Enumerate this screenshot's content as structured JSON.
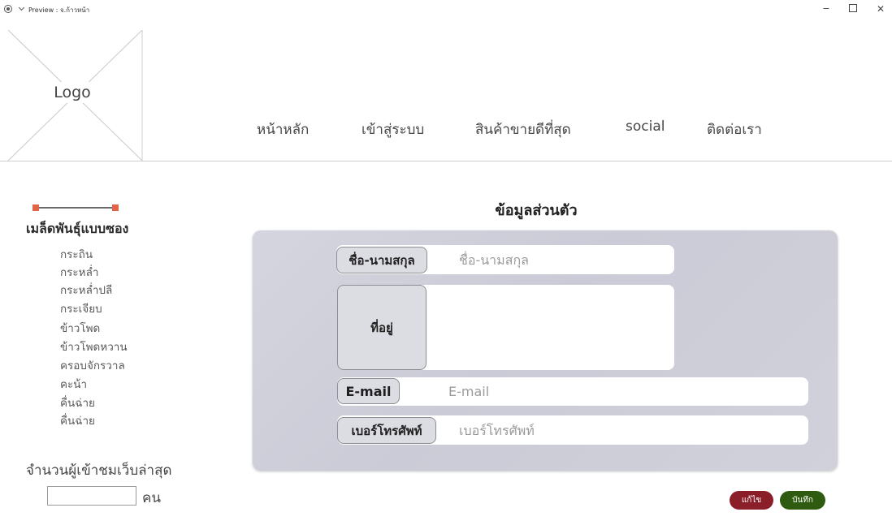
{
  "window": {
    "title": "Preview : จ.ก้าวหน้า",
    "minimize": "−",
    "close": "✕"
  },
  "logo": {
    "text": "Logo"
  },
  "nav": [
    "หน้าหลัก",
    "เข้าสู่ระบบ",
    "สินค้าขายดีที่สุด",
    "social",
    "ติดต่อเรา"
  ],
  "sidebar": {
    "heading": "เมล็ดพันธุ์แบบซอง",
    "items": [
      "กระถิน",
      "กระหล่ำ",
      "กระหล่ำปลี",
      "กระเจียบ",
      "ข้าวโพด",
      "ข้าวโพดหวาน",
      " ครอบจักรวาล",
      "คะน้า",
      "คื่นฉ่าย",
      "คื่นฉ่าย"
    ],
    "visitor_label": "จำนวนผู้เข้าชมเว็บล่าสุด",
    "visitor_unit": "คน"
  },
  "form": {
    "title": "ข้อมูลส่วนตัว",
    "fields": [
      {
        "label": "ชื่อ-นามสกุล",
        "placeholder": "ชื่อ-นามสกุล"
      },
      {
        "label": "ที่อยู่"
      },
      {
        "label": "E-mail",
        "placeholder": "E-mail"
      },
      {
        "label": "เบอร์โทรศัพท์",
        "placeholder": "เบอร์โทรศัพท์"
      }
    ],
    "edit_label": "แก้ไข",
    "save_label": "บันทึก"
  },
  "colors": {
    "slider_handle": "#e2654a",
    "edit_button": "#8a1e29",
    "save_button": "#2e5b10",
    "panel": "#cfcfdb"
  },
  "icons": {
    "window_menu": "target-icon",
    "window_dropdown": "chevron-down-icon",
    "minimize": "minimize-icon",
    "maximize": "maximize-icon",
    "close": "close-icon",
    "logo": "image-placeholder-icon"
  }
}
